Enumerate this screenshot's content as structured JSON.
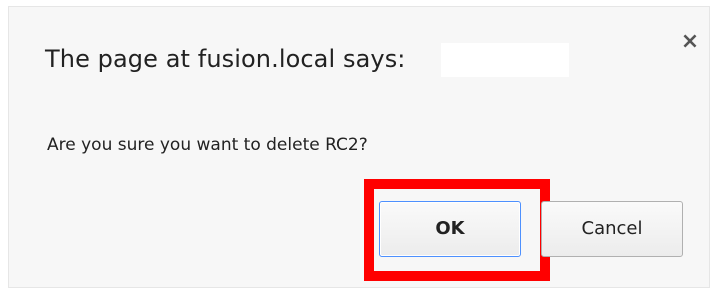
{
  "dialog": {
    "title": "The page at fusion.local says:",
    "message": "Are you sure you want to delete RC2?",
    "close_glyph": "×",
    "close_icon": "close-icon",
    "buttons": {
      "ok_label": "OK",
      "cancel_label": "Cancel"
    },
    "highlight_color": "#ff0000",
    "focus_color": "#4d90fe"
  }
}
